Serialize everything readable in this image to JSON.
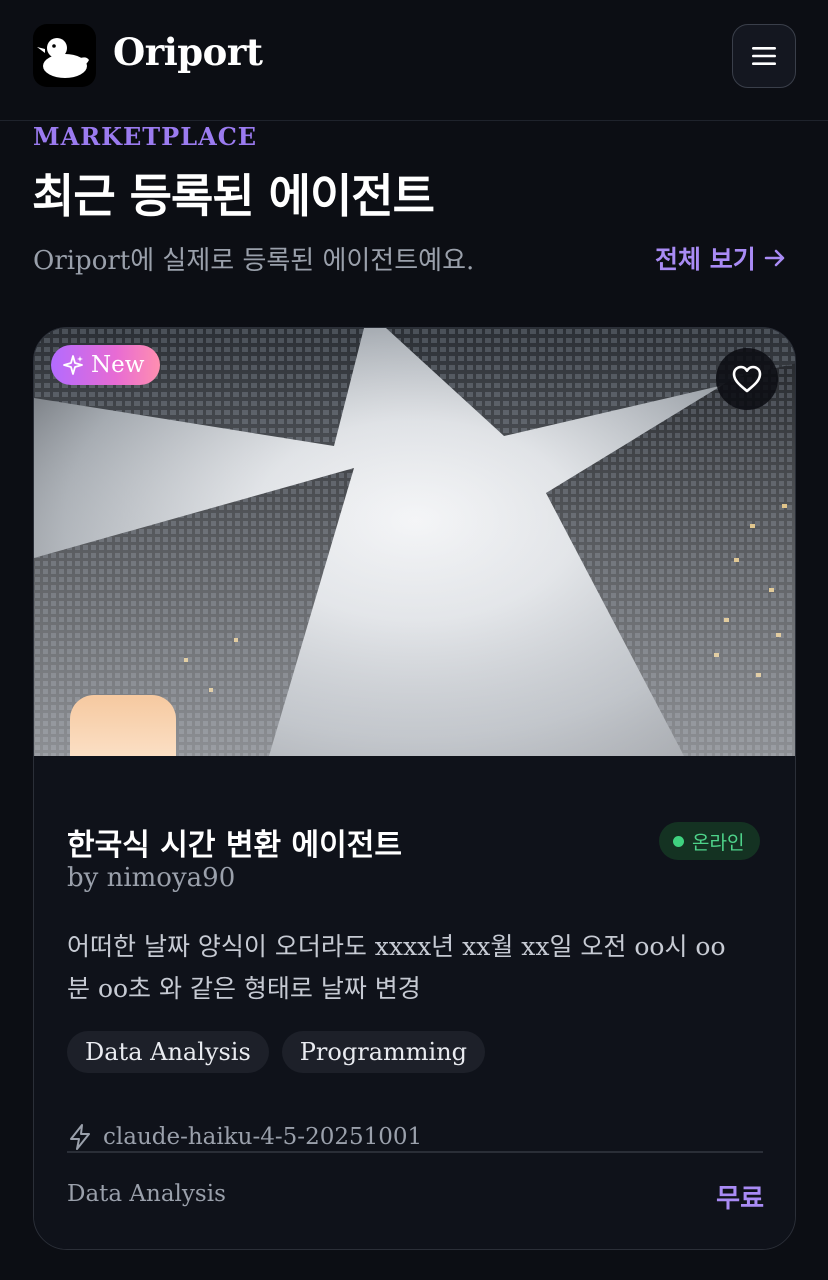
{
  "header": {
    "brand": "Oriport",
    "logo_icon": "duck-icon",
    "menu_icon": "hamburger-menu-icon"
  },
  "section": {
    "eyebrow": "MARKETPLACE",
    "title": "최근 등록된 에이전트",
    "subtitle": "Oriport에 실제로 등록된 에이전트예요.",
    "view_all": "전체 보기",
    "view_all_icon": "arrow-right-icon"
  },
  "card": {
    "badge": "New",
    "badge_icon": "sparkle-icon",
    "favorite_icon": "heart-icon",
    "title": "한국식 시간 변환 에이전트",
    "author": "by nimoya90",
    "status": "온라인",
    "status_color": "#3fd17f",
    "description": "어떠한 날짜 양식이 오더라도 xxxx년 xx월 xx일 오전 oo시 oo분 oo초 와 같은 형태로 날짜 변경",
    "tags": [
      "Data Analysis",
      "Programming"
    ],
    "model": "claude-haiku-4-5-20251001",
    "model_icon": "lightning-icon",
    "footer_category": "Data Analysis",
    "price": "무료"
  },
  "colors": {
    "accent": "#a98bf5",
    "eyebrow": "#9b7bf0",
    "background": "#0c0e14",
    "online": "#3fd17f"
  }
}
